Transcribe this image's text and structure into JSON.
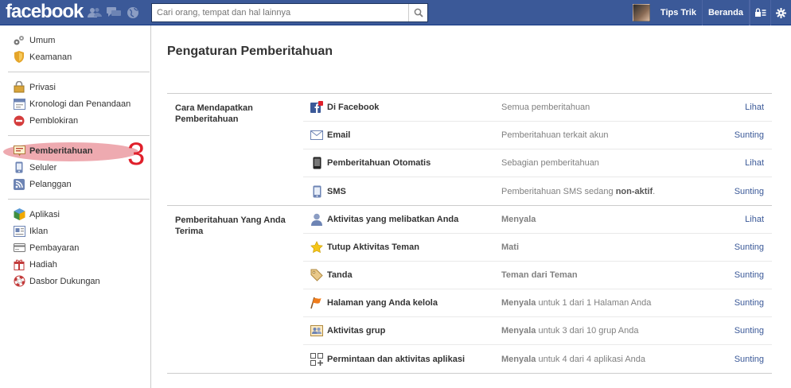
{
  "topbar": {
    "logo": "facebook",
    "search_placeholder": "Cari orang, tempat dan hal lainnya",
    "user_name": "Tips Trik",
    "home": "Beranda"
  },
  "sidebar": {
    "groups": [
      [
        {
          "label": "Umum",
          "icon": "gears-icon"
        },
        {
          "label": "Keamanan",
          "icon": "badge-icon"
        }
      ],
      [
        {
          "label": "Privasi",
          "icon": "lock-icon"
        },
        {
          "label": "Kronologi dan Penandaan",
          "icon": "timeline-icon"
        },
        {
          "label": "Pemblokiran",
          "icon": "block-icon"
        }
      ],
      [
        {
          "label": "Pemberitahuan",
          "icon": "notification-icon"
        },
        {
          "label": "Seluler",
          "icon": "mobile-icon"
        },
        {
          "label": "Pelanggan",
          "icon": "rss-icon"
        }
      ],
      [
        {
          "label": "Aplikasi",
          "icon": "cube-icon"
        },
        {
          "label": "Iklan",
          "icon": "ads-icon"
        },
        {
          "label": "Pembayaran",
          "icon": "card-icon"
        },
        {
          "label": "Hadiah",
          "icon": "gift-icon"
        },
        {
          "label": "Dasbor Dukungan",
          "icon": "lifebuoy-icon"
        }
      ]
    ],
    "marker": "3"
  },
  "main": {
    "title": "Pengaturan Pemberitahuan",
    "sections": [
      {
        "label": "Cara Mendapatkan Pemberitahuan",
        "rows": [
          {
            "name": "Di Facebook",
            "status": "Semua pemberitahuan",
            "action": "Lihat"
          },
          {
            "name": "Email",
            "status": "Pemberitahuan terkait akun",
            "action": "Sunting"
          },
          {
            "name": "Pemberitahuan Otomatis",
            "status": "Sebagian pemberitahuan",
            "action": "Lihat"
          },
          {
            "name": "SMS",
            "status_prefix": "Pemberitahuan SMS sedang ",
            "status_bold": "non-aktif",
            "status_suffix": ".",
            "action": "Sunting"
          }
        ]
      },
      {
        "label": "Pemberitahuan Yang Anda Terima",
        "rows": [
          {
            "name": "Aktivitas yang melibatkan Anda",
            "status_strong": "Menyala",
            "status_rest": "",
            "action": "Lihat"
          },
          {
            "name": "Tutup Aktivitas Teman",
            "status_strong": "Mati",
            "status_rest": "",
            "action": "Sunting"
          },
          {
            "name": "Tanda",
            "status_strong": "Teman dari Teman",
            "status_rest": "",
            "action": "Sunting"
          },
          {
            "name": "Halaman yang Anda kelola",
            "status_strong": "Menyala",
            "status_rest": " untuk 1 dari 1 Halaman Anda",
            "action": "Sunting"
          },
          {
            "name": "Aktivitas grup",
            "status_strong": "Menyala",
            "status_rest": " untuk 3 dari 10 grup Anda",
            "action": "Sunting"
          },
          {
            "name": "Permintaan dan aktivitas aplikasi",
            "status_strong": "Menyala",
            "status_rest": " untuk 4 dari 4 aplikasi Anda",
            "action": "Sunting"
          }
        ]
      }
    ]
  }
}
